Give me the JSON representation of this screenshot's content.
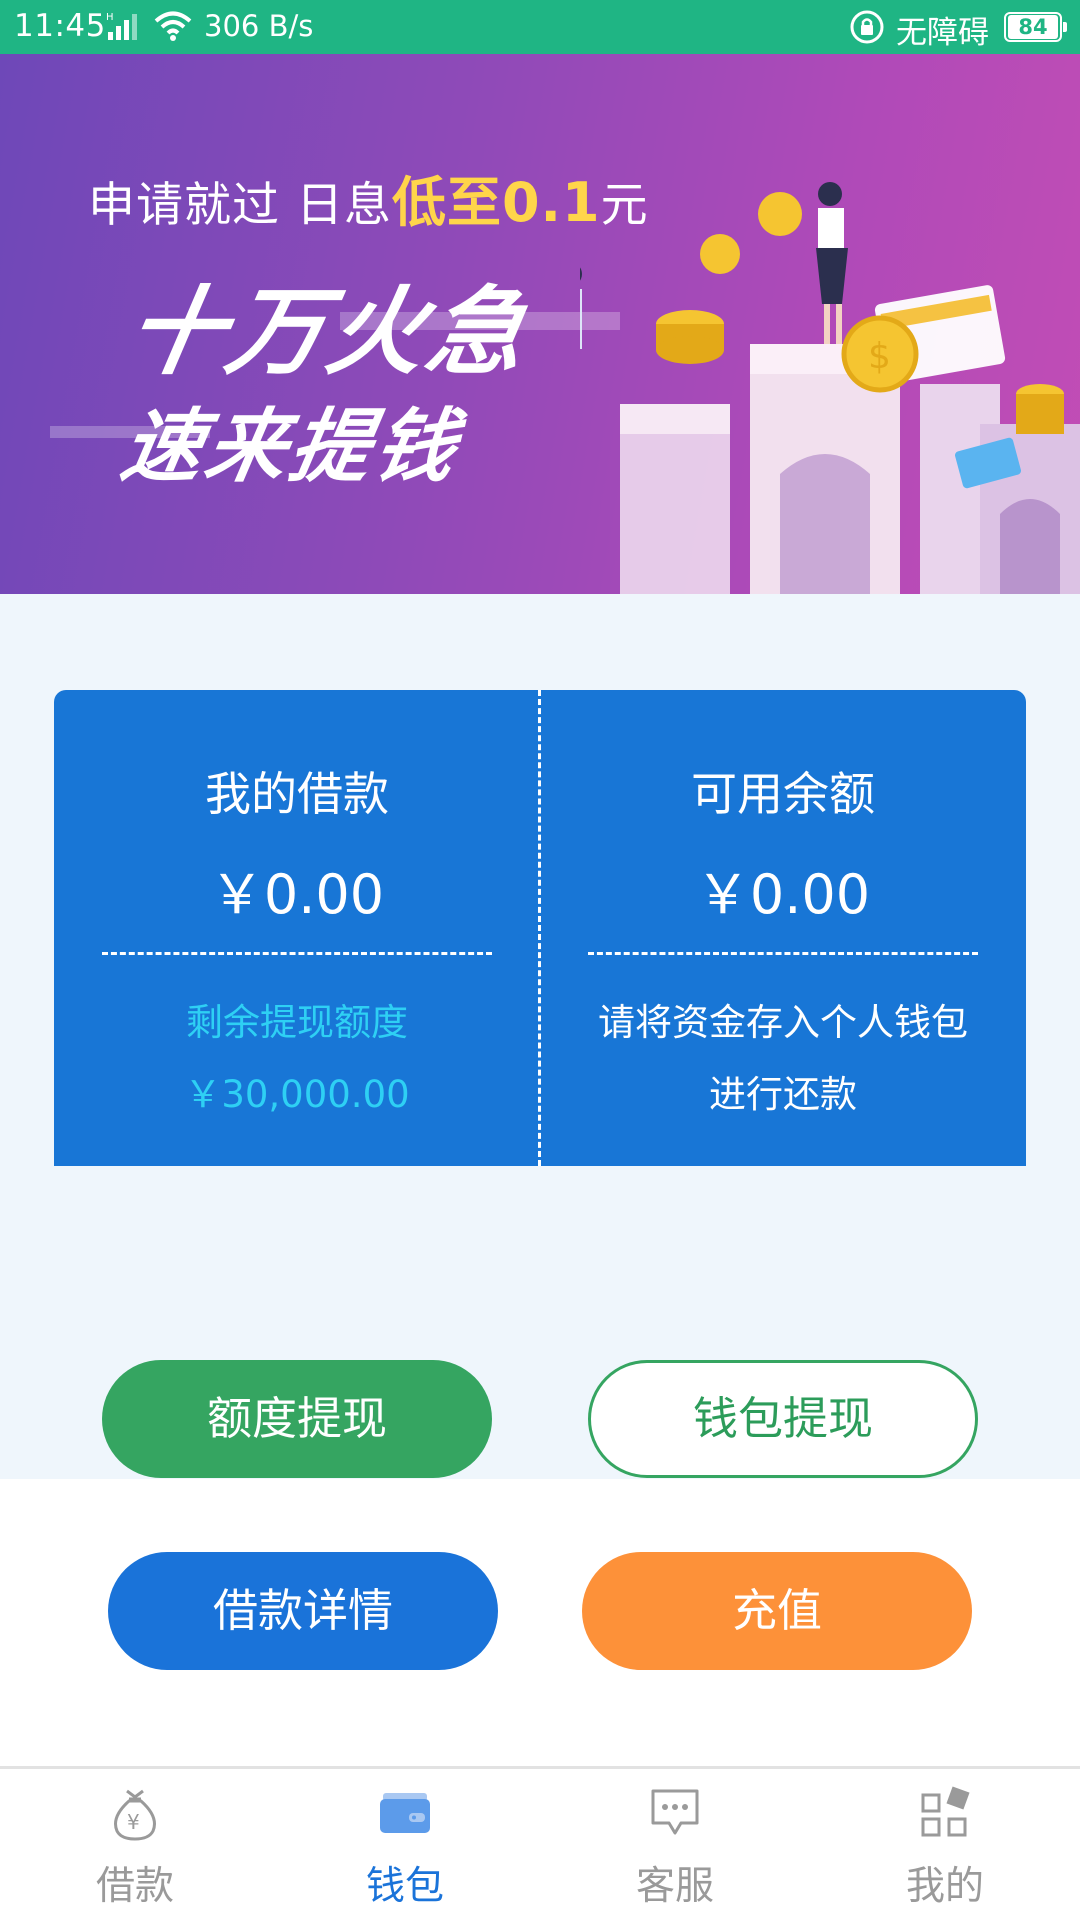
{
  "status_bar": {
    "time": "11:45",
    "network_speed": "306 B/s",
    "accessibility_label": "无障碍",
    "battery": "84"
  },
  "banner": {
    "line1_prefix": "申请就过  日息",
    "line1_highlight": "低至0.1",
    "line1_suffix": "元",
    "slogan_line1": "十万火急",
    "slogan_line2": "速来提钱"
  },
  "card": {
    "left": {
      "title": "我的借款",
      "amount": "￥0.00",
      "sub_label": "剩余提现额度",
      "sub_amount": "￥30,000.00"
    },
    "right": {
      "title": "可用余额",
      "amount": "￥0.00",
      "note_line1": "请将资金存入个人钱包",
      "note_line2": "进行还款"
    }
  },
  "buttons": {
    "quota_withdraw": "额度提现",
    "wallet_withdraw": "钱包提现",
    "loan_detail": "借款详情",
    "recharge": "充值"
  },
  "bottom_nav": {
    "items": [
      {
        "label": "借款",
        "icon": "money-bag-icon",
        "active": false
      },
      {
        "label": "钱包",
        "icon": "wallet-icon",
        "active": true
      },
      {
        "label": "客服",
        "icon": "chat-bubble-icon",
        "active": false
      },
      {
        "label": "我的",
        "icon": "grid-apps-icon",
        "active": false
      }
    ]
  },
  "colors": {
    "status_bar": "#1FB584",
    "card": "#1876D6",
    "accent_blue": "#1A73D9",
    "green": "#35A561",
    "orange": "#FD9139",
    "cyan_text": "#2ED0F4",
    "page_bg": "#EFF6FC"
  }
}
